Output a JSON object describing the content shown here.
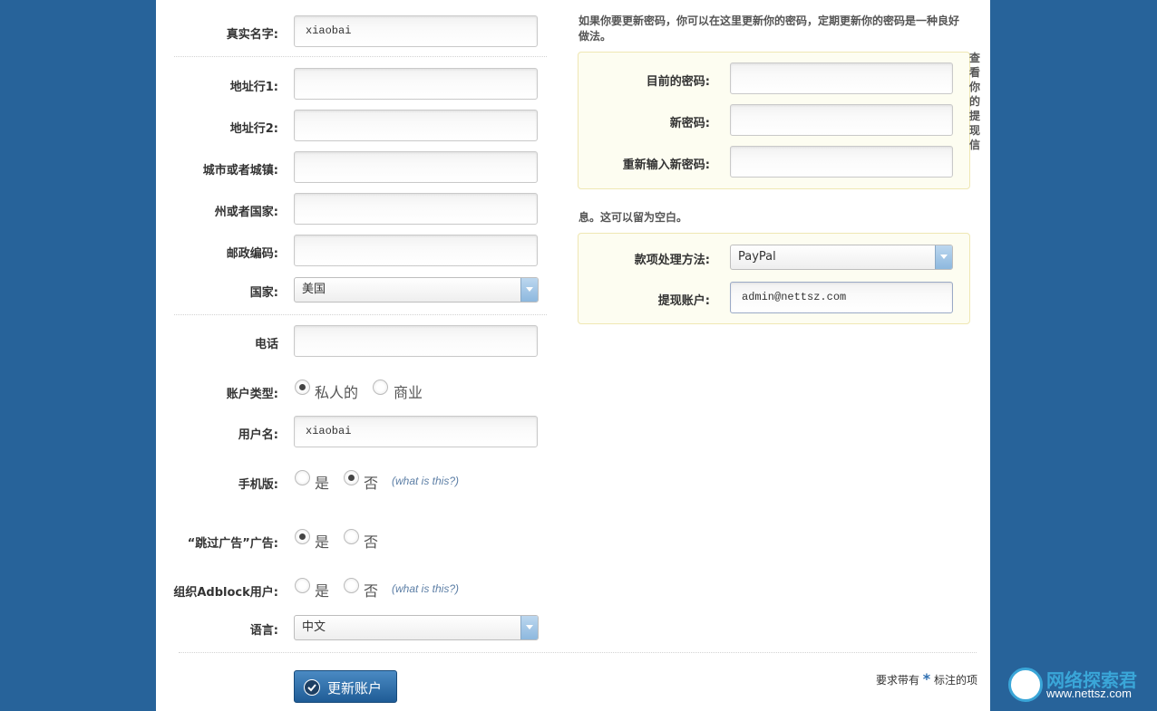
{
  "form": {
    "real_name": {
      "label": "真实名字:",
      "value": "xiaobai"
    },
    "address1": {
      "label": "地址行1:",
      "value": ""
    },
    "address2": {
      "label": "地址行2:",
      "value": ""
    },
    "city": {
      "label": "城市或者城镇:",
      "value": ""
    },
    "state": {
      "label": "州或者国家:",
      "value": ""
    },
    "postcode": {
      "label": "邮政编码:",
      "value": ""
    },
    "country": {
      "label": "国家:",
      "selected": "美国"
    },
    "phone": {
      "label": "电话",
      "value": ""
    },
    "account_type": {
      "label": "账户类型:",
      "options": [
        "私人的",
        "商业"
      ],
      "selected": "私人的"
    },
    "username": {
      "label": "用户名:",
      "value": "xiaobai"
    },
    "mobile": {
      "label": "手机版:",
      "options": [
        "是",
        "否"
      ],
      "selected": "否",
      "help": "(what is this?)"
    },
    "skip_ads": {
      "label": "“跳过广告”广告:",
      "options": [
        "是",
        "否"
      ],
      "selected": "是"
    },
    "adblock": {
      "label": "组织Adblock用户:",
      "options": [
        "是",
        "否"
      ],
      "selected": null,
      "help": "(what is this?)"
    },
    "language": {
      "label": "语言:",
      "selected": "中文"
    }
  },
  "password": {
    "note": "如果你要更新密码，你可以在这里更新你的密码，定期更新你的密码是一种良好做法。",
    "current": {
      "label": "目前的密码:",
      "value": ""
    },
    "new": {
      "label": "新密码:",
      "value": ""
    },
    "confirm": {
      "label": "重新输入新密码:",
      "value": ""
    }
  },
  "withdraw": {
    "side_note": "查看你的提现信",
    "note": "息。这可以留为空白。",
    "method": {
      "label": "款项处理方法:",
      "selected": "PayPal"
    },
    "account": {
      "label": "提现账户:",
      "value": "admin@nettsz.com"
    }
  },
  "footer": {
    "submit": "更新账户",
    "required_prefix": "要求带有",
    "required_star": "*",
    "required_suffix": "标注的项"
  },
  "watermark": {
    "name": "网络探索君",
    "url": "www.nettsz.com"
  }
}
